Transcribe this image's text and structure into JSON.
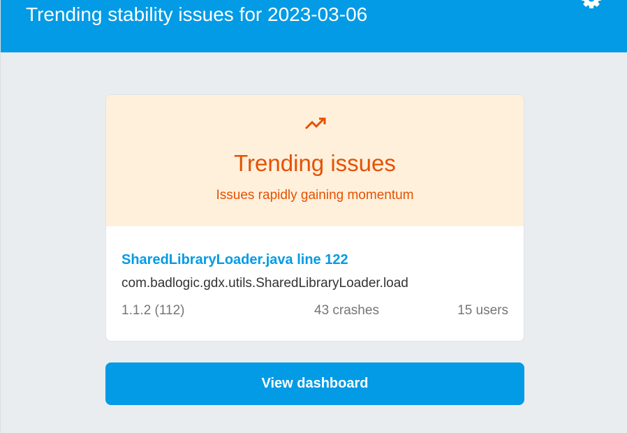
{
  "header": {
    "title": "Trending stability issues for 2023-03-06",
    "settings_icon": "gear-icon"
  },
  "card": {
    "hero": {
      "icon": "trending-up-icon",
      "title": "Trending issues",
      "subtitle": "Issues rapidly gaining momentum",
      "accent_color": "#e65100",
      "background_color": "#fff0dc"
    },
    "issue": {
      "title": "SharedLibraryLoader.java line 122",
      "method": "com.badlogic.gdx.utils.SharedLibraryLoader.load",
      "version": "1.1.2 (112)",
      "crashes": "43 crashes",
      "users": "15 users"
    }
  },
  "cta": {
    "label": "View dashboard"
  },
  "colors": {
    "brand": "#039be5",
    "page_background": "#e9edf0"
  }
}
